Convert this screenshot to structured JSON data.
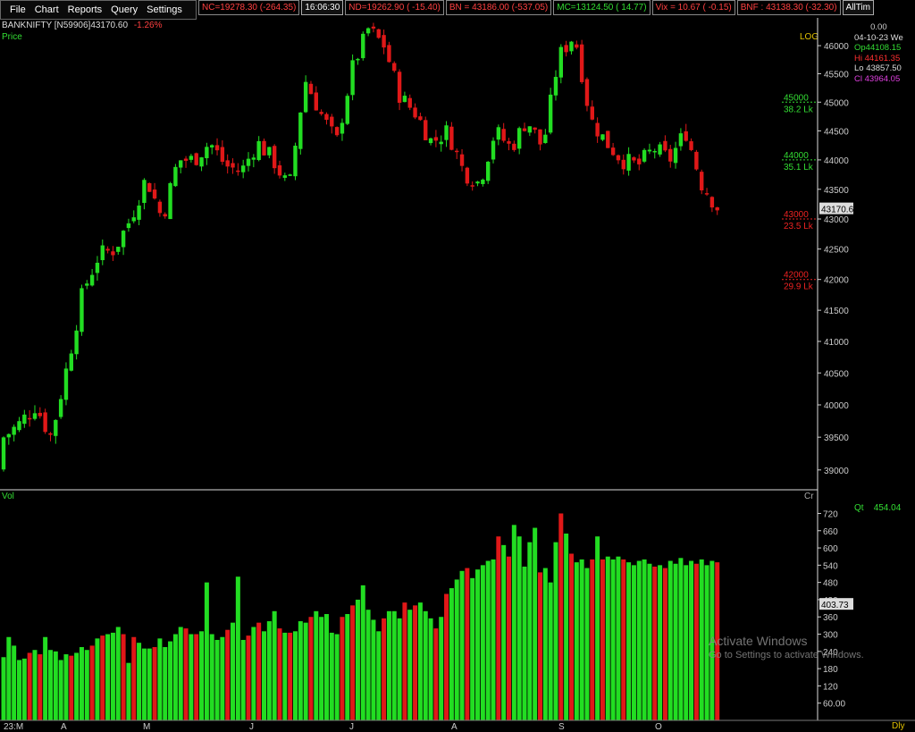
{
  "menu": {
    "file": "File",
    "chart": "Chart",
    "reports": "Reports",
    "query": "Query",
    "settings": "Settings"
  },
  "tickers": [
    {
      "text": "NC=19278.30 (-264.35)",
      "dir": "down"
    },
    {
      "text": "16:06:30",
      "dir": "clock"
    },
    {
      "text": "ND=19262.90 ( -15.40)",
      "dir": "down"
    },
    {
      "text": "BN = 43186.00 (-537.05)",
      "dir": "down"
    },
    {
      "text": "MC=13124.50 (  14.77)",
      "dir": "up"
    },
    {
      "text": "Vix =    10.67 ( -0.15)",
      "dir": "down"
    },
    {
      "text": "BNF : 43138.30 (-32.30)",
      "dir": "down"
    },
    {
      "text": "AllTim",
      "dir": "clock"
    }
  ],
  "symbol": {
    "name": "BANKNIFTY [N59906]",
    "last": "43170.60",
    "change": "-1.26%"
  },
  "labels": {
    "price": "Price",
    "log": "LOG",
    "vol": "Vol",
    "cr": "Cr",
    "dly": "Dly"
  },
  "ohlc": {
    "top": "0.00",
    "date": "04-10-23 We",
    "open": "Op44108.15",
    "high": "Hi  44161.35",
    "low": "Lo  43857.50",
    "close": "Cl  43964.05"
  },
  "qt": {
    "label": "Qt",
    "value": "454.04"
  },
  "watermark": {
    "title": "Activate Windows",
    "subtitle": "Go to Settings to activate Windows."
  },
  "colors": {
    "up": "#22dd22",
    "down": "#e01818",
    "axis": "#cccccc",
    "level_up": "#33dd33",
    "level_down": "#ee2222"
  },
  "chart_data": [
    {
      "type": "candlestick",
      "title": "BANKNIFTY",
      "ylabel": "Price",
      "scale": "log",
      "ylim": [
        38700,
        46500
      ],
      "y_ticks": [
        39000,
        39500,
        40000,
        40500,
        41000,
        41500,
        42000,
        42500,
        43000,
        43500,
        44000,
        44500,
        45000,
        45500,
        46000
      ],
      "x_tick_labels": [
        "23:M",
        "A",
        "M",
        "J",
        "J",
        "A",
        "S",
        "O"
      ],
      "last_price": "43170.6",
      "levels": [
        {
          "price": 45000,
          "label1": "45000",
          "label2": "38.2 Lk",
          "dir": "up"
        },
        {
          "price": 44000,
          "label1": "44000",
          "label2": "35.1 Lk",
          "dir": "up"
        },
        {
          "price": 43000,
          "label1": "43000",
          "label2": "23.5 Lk",
          "dir": "down"
        },
        {
          "price": 42000,
          "label1": "42000",
          "label2": "29.9 Lk",
          "dir": "down"
        }
      ],
      "anchors": [
        39500,
        39700,
        40000,
        39500,
        40600,
        41800,
        42400,
        42500,
        43000,
        43700,
        43000,
        44000,
        44000,
        44300,
        43900,
        43800,
        44300,
        44000,
        43500,
        45400,
        44800,
        44300,
        45600,
        46300,
        46000,
        45100,
        44800,
        44300,
        44500,
        43800,
        43600,
        44500,
        44200,
        44700,
        44200,
        45800,
        46200,
        44700,
        44300,
        44000,
        43900,
        44200,
        44000,
        44500,
        43600,
        43200
      ]
    },
    {
      "type": "bar",
      "title": "Vol",
      "ylabel": "Cr",
      "ylim": [
        0,
        765
      ],
      "y_ticks": [
        60,
        120,
        180,
        240,
        300,
        360,
        420,
        480,
        540,
        600,
        660,
        720
      ],
      "last_value": "403.73",
      "values": [
        220,
        290,
        260,
        210,
        215,
        235,
        245,
        230,
        290,
        245,
        240,
        210,
        230,
        225,
        235,
        255,
        245,
        260,
        285,
        295,
        300,
        305,
        325,
        300,
        200,
        290,
        270,
        250,
        250,
        255,
        285,
        255,
        275,
        300,
        325,
        320,
        300,
        300,
        310,
        480,
        300,
        280,
        290,
        315,
        340,
        500,
        280,
        295,
        325,
        340,
        310,
        345,
        380,
        320,
        305,
        305,
        310,
        345,
        340,
        360,
        380,
        360,
        370,
        305,
        300,
        360,
        370,
        400,
        420,
        470,
        385,
        350,
        310,
        355,
        380,
        380,
        355,
        410,
        385,
        400,
        410,
        380,
        355,
        320,
        360,
        440,
        460,
        490,
        520,
        530,
        495,
        525,
        540,
        555,
        560,
        640,
        610,
        570,
        680,
        640,
        535,
        620,
        670,
        515,
        530,
        480,
        620,
        720,
        650,
        580,
        550,
        560,
        530,
        560,
        640,
        560,
        570,
        560,
        570,
        560,
        550,
        540,
        555,
        560,
        545,
        535,
        540,
        530,
        555,
        545,
        565,
        540,
        555,
        545,
        560,
        540,
        555,
        550
      ]
    }
  ]
}
